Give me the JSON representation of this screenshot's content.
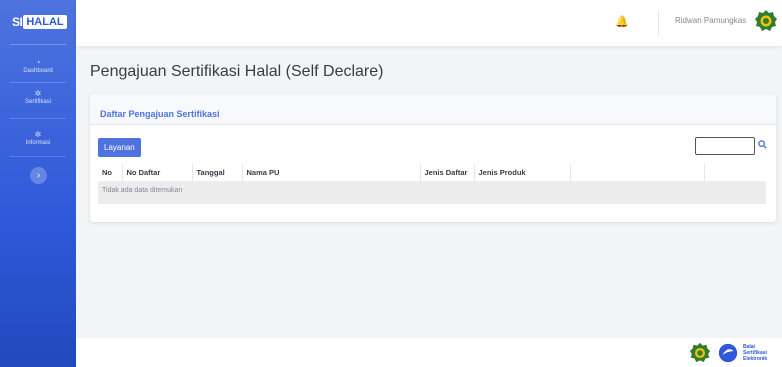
{
  "brand": {
    "prefix": "SI",
    "name": "HALAL"
  },
  "sidebar": {
    "items": [
      {
        "label": "Dashboard",
        "icon": "dashboard-icon"
      },
      {
        "label": "Sertifikasi",
        "icon": "gear-icon"
      },
      {
        "label": "Informasi",
        "icon": "info-icon"
      }
    ],
    "toggle_icon": "›"
  },
  "topbar": {
    "username": "Ridwan Pamungkas",
    "bell_icon": "🔔"
  },
  "page": {
    "title": "Pengajuan Sertifikasi Halal (Self Declare)"
  },
  "card": {
    "title": "Daftar Pengajuan Sertifikasi",
    "button_label": "Layanan",
    "search_value": "",
    "search_icon": "🔍"
  },
  "table": {
    "columns": [
      "No",
      "No Daftar",
      "Tanggal",
      "Nama PU",
      "Jenis Daftar",
      "Jenis Produk",
      "",
      ""
    ],
    "empty_message": "Tidak ada data ditemukan"
  },
  "footer": {
    "logo_text": [
      "Balai",
      "Sertifikasi",
      "Elektronik"
    ]
  },
  "colors": {
    "primary": "#4e73df",
    "sidebar_dark": "#224abe",
    "emblem_green": "#2e7d32",
    "emblem_gold": "#f2c200"
  }
}
